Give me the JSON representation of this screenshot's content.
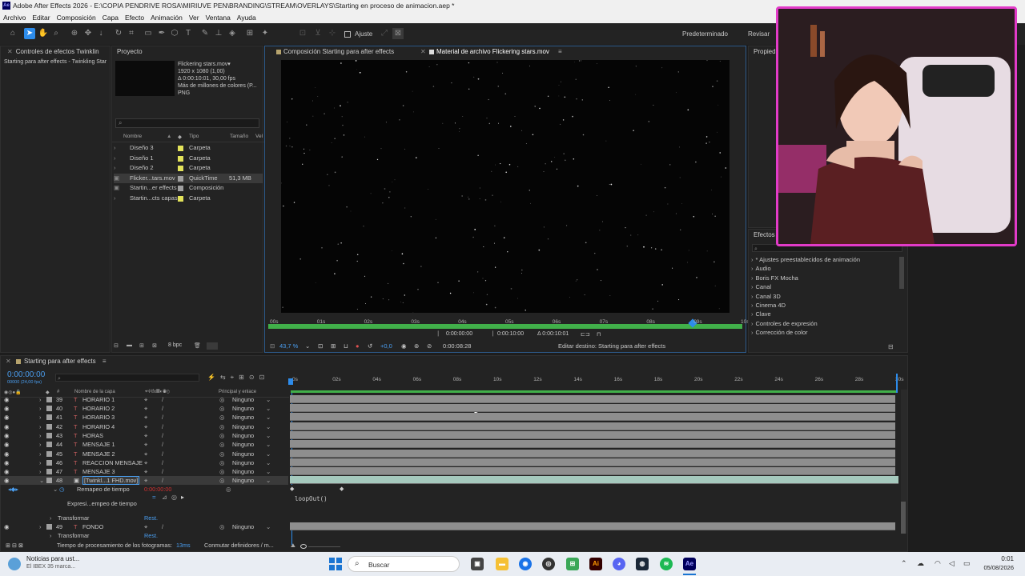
{
  "window": {
    "title": "Adobe After Effects 2026 - E:\\COPIA PENDRIVE ROSA\\MIRIUVE PEN\\BRANDING\\STREAM\\OVERLAYS\\Starting en proceso de animacion.aep *"
  },
  "menu": [
    "Archivo",
    "Editar",
    "Composición",
    "Capa",
    "Efecto",
    "Animación",
    "Ver",
    "Ventana",
    "Ayuda"
  ],
  "toolbar": {
    "snap_label": "Ajuste",
    "workspace": "Predeterminado",
    "review": "Revisar"
  },
  "effects_controls": {
    "tab": "Controles de efectos Twinklin",
    "subtitle": "Starting para after effects - Twinkling Star"
  },
  "project": {
    "tab": "Proyecto",
    "preview_name": "Flickering stars.mov▾",
    "preview_res": "1920 x 1080 (1,00)",
    "preview_dur": "Δ 0:00:10:01, 30,00 fps",
    "preview_colors": "Más de millones de colores (P...",
    "preview_fmt": "PNG",
    "search_placeholder": "",
    "columns": [
      "Nombre",
      "Tipo",
      "Tamaño",
      "Vel"
    ],
    "items": [
      {
        "name": "Diseño 3",
        "type": "Carpeta",
        "size": "",
        "color": "#e3e35a"
      },
      {
        "name": "Diseño 1",
        "type": "Carpeta",
        "size": "",
        "color": "#e3e35a"
      },
      {
        "name": "Diseño 2",
        "type": "Carpeta",
        "size": "",
        "color": "#e3e35a"
      },
      {
        "name": "Flicker...tars.mov",
        "type": "QuickTime",
        "size": "51,3 MB",
        "color": "#a0a0a0"
      },
      {
        "name": "Startin...er effects",
        "type": "Composición",
        "size": "",
        "color": "#a0a0a0"
      },
      {
        "name": "Startin...cts capas",
        "type": "Carpeta",
        "size": "",
        "color": "#e3e35a"
      }
    ],
    "bpc": "8 bpc"
  },
  "viewer": {
    "tab_comp": "Composición Starting para after effects",
    "tab_footage": "Material de archivo Flickering stars.mov",
    "ruler": [
      "00s",
      "01s",
      "02s",
      "03s",
      "04s",
      "05s",
      "06s",
      "07s",
      "08s",
      "09s",
      "10s"
    ],
    "in_time": "0:00:00:00",
    "out_time": "0:00:10:00",
    "duration": "Δ 0:00:10:01",
    "zoom": "43,7 %",
    "exposure": "+0,0",
    "current": "0:00:08:28",
    "edit_target": "Editar destino: Starting para after effects"
  },
  "effects_presets": {
    "tab": "Efectos y",
    "propiedades_tab": "Propied",
    "items": [
      "* Ajustes preestablecidos de animación",
      "Audio",
      "Boris FX Mocha",
      "Canal",
      "Canal 3D",
      "Cinema 4D",
      "Clave",
      "Controles de expresión",
      "Corrección de color"
    ]
  },
  "timeline": {
    "tab": "Starting para after effects",
    "timecode": "0:00:00:00",
    "fps": "00000 (24,00 fps)",
    "col_num": "#",
    "col_name": "Nombre de la capa",
    "col_parent": "Principal y enlace",
    "ruler": [
      "0s",
      "02s",
      "04s",
      "06s",
      "08s",
      "10s",
      "12s",
      "14s",
      "16s",
      "18s",
      "20s",
      "22s",
      "24s",
      "26s",
      "28s",
      "30s"
    ],
    "partial_layer": {
      "num": "39",
      "name": "HORARIO 1",
      "parent": "Ninguno"
    },
    "layers": [
      {
        "num": "40",
        "name": "HORARIO 2",
        "parent": "Ninguno"
      },
      {
        "num": "41",
        "name": "HORARIO 3",
        "parent": "Ninguno"
      },
      {
        "num": "42",
        "name": "HORARIO 4",
        "parent": "Ninguno"
      },
      {
        "num": "43",
        "name": "HORAS",
        "parent": "Ninguno"
      },
      {
        "num": "44",
        "name": "MENSAJE 1",
        "parent": "Ninguno"
      },
      {
        "num": "45",
        "name": "MENSAJE 2",
        "parent": "Ninguno"
      },
      {
        "num": "46",
        "name": "REACCION MENSAJE",
        "parent": "Ninguno"
      },
      {
        "num": "47",
        "name": "MENSAJE 3",
        "parent": "Ninguno"
      }
    ],
    "selected_layer": {
      "num": "48",
      "name": "[Twinkl...1 FHD.mov]",
      "parent": "Ninguno"
    },
    "remap_label": "Remapeo de tiempo",
    "remap_value": "0:00:00:00",
    "expr_label": "Expresi...empeo de tiempo",
    "expression": "loopOut()",
    "transform_label": "Transformar",
    "reset_label": "Rest.",
    "fondo_layer": {
      "num": "49",
      "name": "FONDO",
      "parent": "Ninguno"
    },
    "transform2_label": "Transformar",
    "reset2_label": "Rest.",
    "status_render": "Tiempo de procesamiento de los fotogramas:",
    "render_ms": "13ms",
    "toggle_label": "Conmutar definidores / m..."
  },
  "taskbar": {
    "news_title": "Noticias para ust...",
    "news_sub": "El IBEX 35 marca...",
    "search_placeholder": "Buscar",
    "time": "0:01",
    "date": "05/08/2026"
  },
  "colors": {
    "accent_blue": "#2d8ceb",
    "timecode_blue": "#4a9ef0",
    "layer_bar": "#8e8e8e",
    "selected_bar": "#a5c9bd",
    "green_bar": "#41b04a"
  }
}
